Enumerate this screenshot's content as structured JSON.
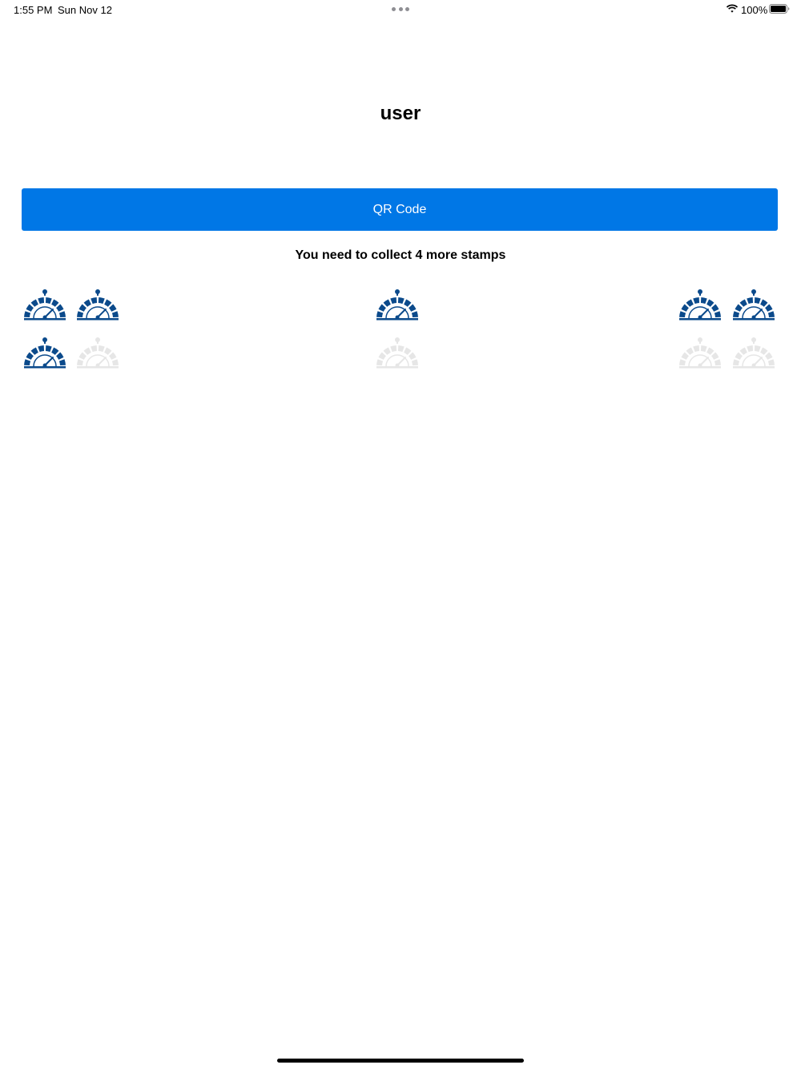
{
  "status_bar": {
    "time": "1:55 PM",
    "date": "Sun Nov 12",
    "battery": "100%",
    "icons": [
      "multitask-dots-icon",
      "wifi-icon",
      "battery-icon"
    ]
  },
  "page": {
    "title": "user"
  },
  "qr_button": {
    "label": "QR Code",
    "color": "#0077e6"
  },
  "stamps": {
    "message": "You need to collect 4 more stamps",
    "collected_color": "#0b4a8b",
    "empty_color": "#e6e6e6",
    "icon": "gauge-stamp-icon",
    "total": 10,
    "collected": 6,
    "items": [
      {
        "collected": true
      },
      {
        "collected": true
      },
      {
        "collected": true
      },
      {
        "collected": true
      },
      {
        "collected": true
      },
      {
        "collected": true
      },
      {
        "collected": false
      },
      {
        "collected": false
      },
      {
        "collected": false
      },
      {
        "collected": false
      }
    ]
  }
}
